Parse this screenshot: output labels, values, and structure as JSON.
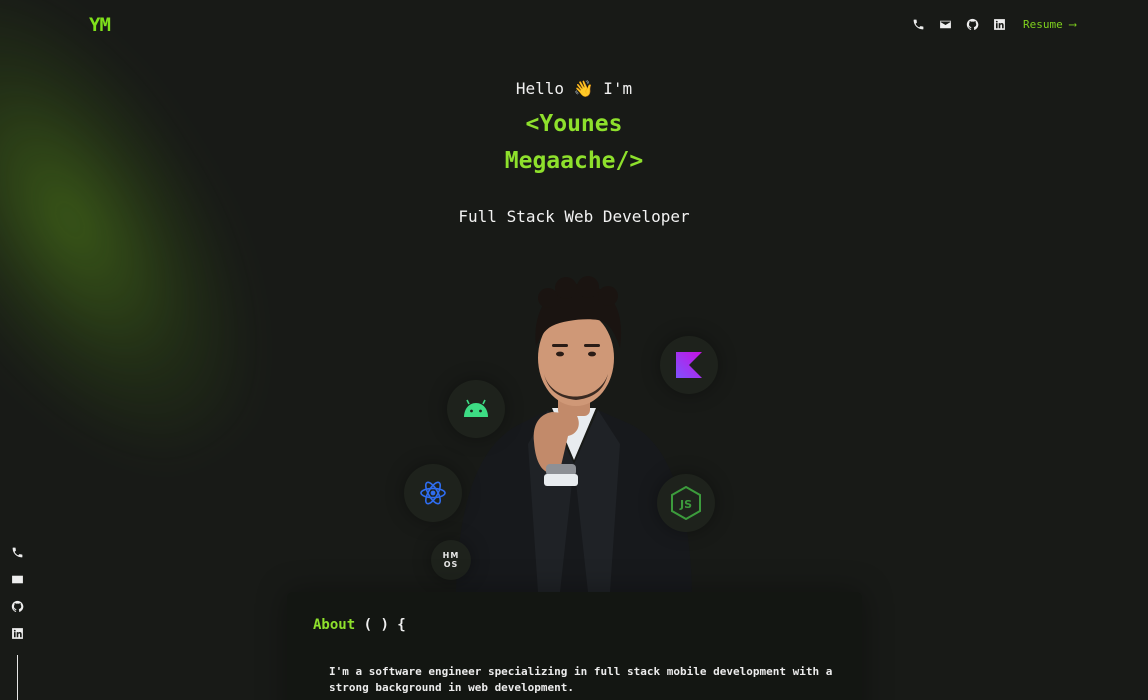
{
  "header": {
    "logo": "YM",
    "nav_icons": [
      "phone-icon",
      "mail-icon",
      "github-icon",
      "linkedin-icon"
    ],
    "resume_label": "Resume ⟶"
  },
  "hero": {
    "greeting": "Hello 👋 I'm",
    "name_line1": "<Younes",
    "name_line2": "Megaache/>",
    "role": "Full Stack Web Developer",
    "tech_badges": [
      "android-icon",
      "react-icon",
      "hmos-icon",
      "kotlin-icon",
      "nodejs-icon"
    ],
    "hmos_text": "HM OS"
  },
  "side_rail": {
    "icons": [
      "phone-icon",
      "mail-icon",
      "github-icon",
      "linkedin-icon"
    ]
  },
  "about": {
    "keyword": "About",
    "signature": " ( ) {",
    "text": "I'm a software engineer specializing in full stack mobile development with a strong background in web development."
  },
  "colors": {
    "accent": "#8ee02c",
    "background": "#181a17",
    "card": "#131612"
  }
}
